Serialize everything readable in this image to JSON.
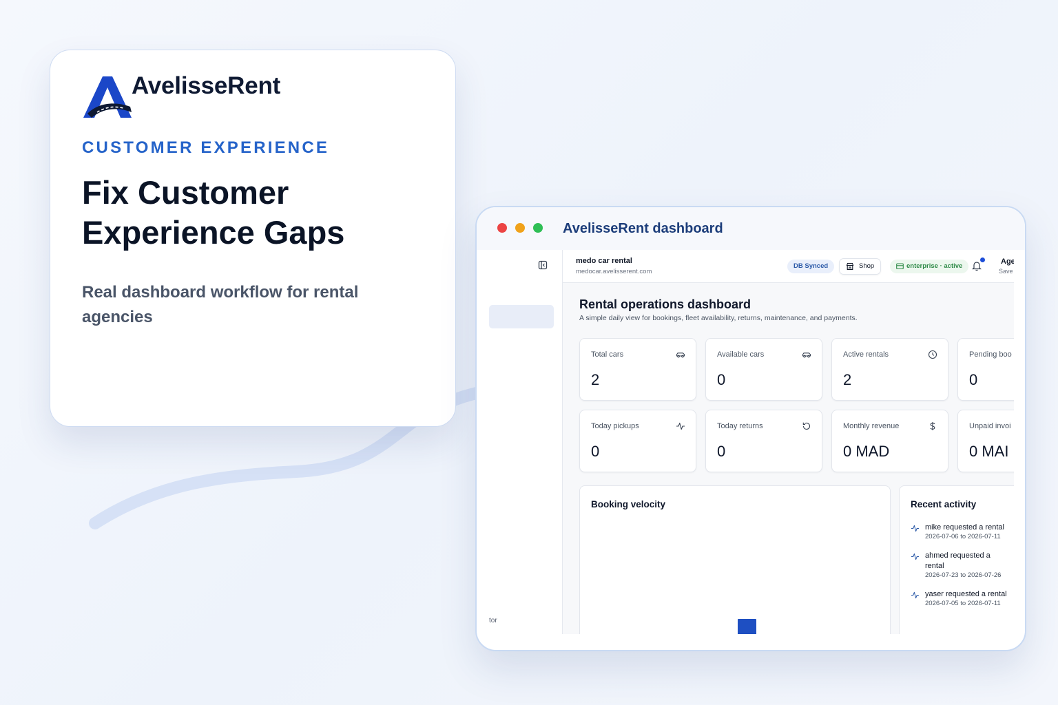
{
  "hero": {
    "brand": "AvelisseRent",
    "eyebrow": "CUSTOMER EXPERIENCE",
    "headline": "Fix Customer Experience Gaps",
    "subline": "Real dashboard workflow for rental agencies"
  },
  "window": {
    "title": "AvelisseRent dashboard"
  },
  "sidebar": {
    "footer_text": "tor"
  },
  "topbar": {
    "tenant_name": "medo car rental",
    "tenant_domain": "medocar.avelisserent.com",
    "db_status": "DB Synced",
    "shop_label": "Shop",
    "plan_status": "enterprise · active",
    "user_name": "Age",
    "user_sub": "Save"
  },
  "dashboard": {
    "title": "Rental operations dashboard",
    "description": "A simple daily view for bookings, fleet availability, returns, maintenance, and payments.",
    "stats": [
      {
        "label": "Total cars",
        "value": "2",
        "icon": "car-icon"
      },
      {
        "label": "Available cars",
        "value": "0",
        "icon": "car-icon"
      },
      {
        "label": "Active rentals",
        "value": "2",
        "icon": "clock-icon"
      },
      {
        "label": "Pending boo",
        "value": "0",
        "icon": ""
      },
      {
        "label": "Today pickups",
        "value": "0",
        "icon": "activity-icon"
      },
      {
        "label": "Today returns",
        "value": "0",
        "icon": "rotate-icon"
      },
      {
        "label": "Monthly revenue",
        "value": "0 MAD",
        "icon": "dollar-icon"
      },
      {
        "label": "Unpaid invoi",
        "value": "0 MAI",
        "icon": ""
      }
    ],
    "booking_velocity": {
      "title": "Booking velocity"
    },
    "recent_activity": {
      "title": "Recent activity",
      "items": [
        {
          "text": "mike requested a rental",
          "dates": "2026-07-06 to 2026-07-11"
        },
        {
          "text": "ahmed requested a rental",
          "dates": "2026-07-23 to 2026-07-26"
        },
        {
          "text": "yaser requested a rental",
          "dates": "2026-07-05 to 2026-07-11"
        }
      ]
    }
  },
  "colors": {
    "accent": "#2563c9",
    "brand_navy": "#1c3d7a",
    "bar": "#1e4fc2",
    "success": "#2e8a47"
  }
}
